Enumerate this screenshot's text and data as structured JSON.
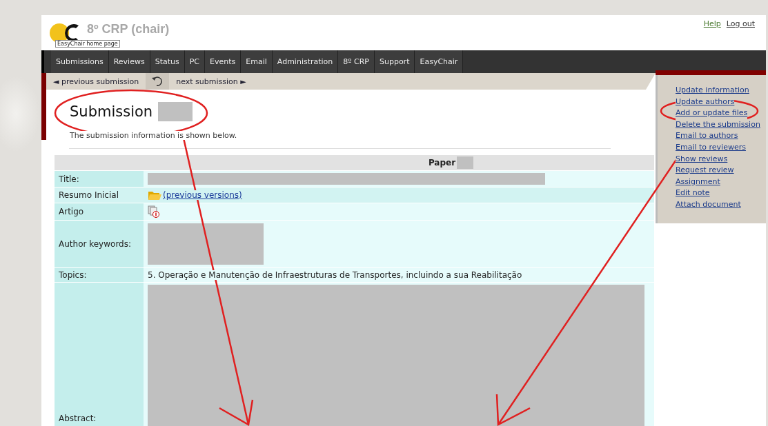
{
  "header": {
    "logo_tooltip": "EasyChair home page",
    "title": "8º CRP (chair)",
    "links": [
      "Help",
      "Log out"
    ]
  },
  "menu": [
    "Submissions",
    "Reviews",
    "Status",
    "PC",
    "Events",
    "Email",
    "Administration",
    "8º CRP",
    "Support",
    "EasyChair"
  ],
  "subnav": {
    "previous": "◄ previous submission",
    "next": "next submission ►"
  },
  "heading": "Submission",
  "intro": "The submission information is shown below.",
  "table": {
    "header": "Paper",
    "rows": [
      {
        "label": "Title:",
        "kind": "redacted"
      },
      {
        "label": "Resumo Inicial",
        "kind": "file",
        "link": "(previous versions)"
      },
      {
        "label": "Artigo",
        "kind": "attachment"
      },
      {
        "label": "Author keywords:",
        "kind": "redacted-block"
      },
      {
        "label": "Topics:",
        "kind": "text",
        "value": "5. Operação e Manutenção de Infraestruturas de Transportes, incluindo a sua Reabilitação"
      },
      {
        "label": "Abstract:",
        "kind": "redacted-large"
      }
    ]
  },
  "actions": [
    "Update information",
    "Update authors",
    "Add or update files",
    "Delete the submission",
    "Email to authors",
    "Email to reviewers",
    "Show reviews",
    "Request review",
    "Assignment",
    "Edit note",
    "Attach document"
  ]
}
